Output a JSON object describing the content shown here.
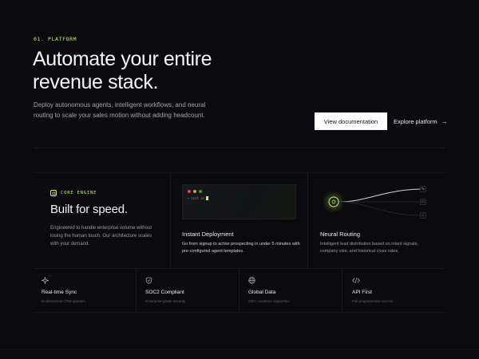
{
  "hero": {
    "eyebrow": "01. PLATFORM",
    "title_line1": "Automate your entire",
    "title_line2": "revenue stack.",
    "subtitle": "Deploy autonomous agents, intelligent workflows, and neural routing to scale your sales motion without adding headcount.",
    "primary_button": "View documentation",
    "secondary_button": "Explore platform",
    "secondary_icon": "→"
  },
  "core": {
    "tag": "CORE ENGINE",
    "title": "Built for speed.",
    "description": "Engineered to handle enterprise volume without losing the human touch. Our architecture scales with your demand."
  },
  "deployment": {
    "terminal_prompt": "→",
    "terminal_command": "init ai",
    "title": "Instant Deployment",
    "description": "Go from signup to active prospecting in under 5 minutes with pre-configured agent templates."
  },
  "routing": {
    "title": "Neural Routing",
    "description": "Intelligent lead distribution based on intent signals, company size, and historical close rates."
  },
  "stats": [
    {
      "icon": "sparkle-icon",
      "title": "Real-time Sync",
      "description": "Bi-directional CRM updates."
    },
    {
      "icon": "shield-icon",
      "title": "SOC2 Compliant",
      "description": "Enterprise-grade security."
    },
    {
      "icon": "globe-icon",
      "title": "Global Data",
      "description": "200+ countries supported."
    },
    {
      "icon": "code-icon",
      "title": "API First",
      "description": "Full programmatic access."
    }
  ],
  "colors": {
    "background": "#0b0b0d",
    "accent": "#c6f36b",
    "text": "#f4f4f6",
    "muted": "#9c9ca4"
  }
}
